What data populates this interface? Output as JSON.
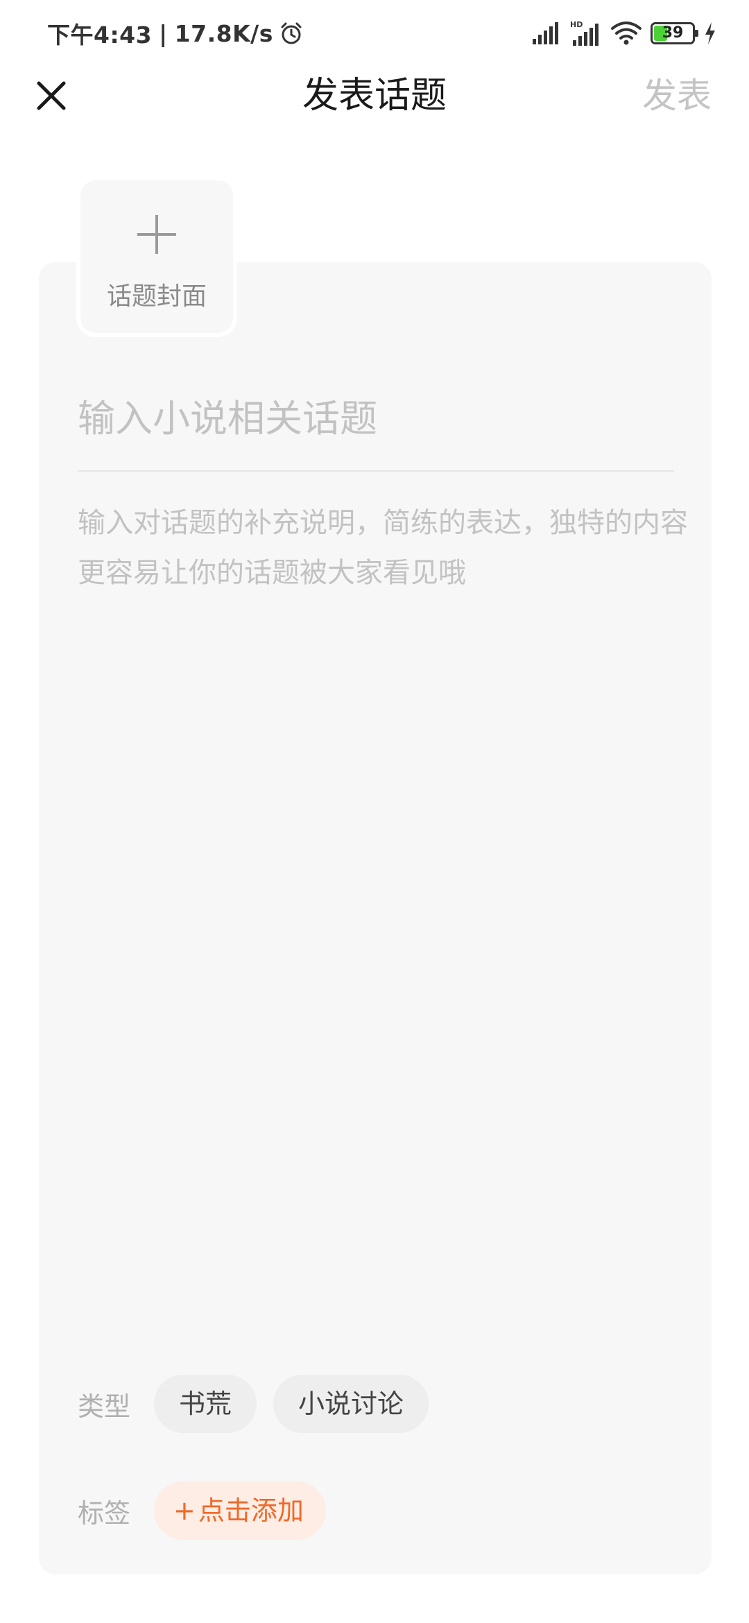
{
  "status_bar": {
    "time": "下午4:43",
    "separator": "|",
    "network_speed": "17.8K/s",
    "battery_level": "39",
    "battery_fraction": 0.39,
    "icons": [
      "alarm-icon",
      "cellular-signal-icon",
      "hd-cellular-signal-icon",
      "wifi-icon",
      "battery-icon",
      "charging-icon"
    ]
  },
  "nav": {
    "title": "发表话题",
    "publish_label": "发表",
    "close_icon": "close-icon"
  },
  "editor": {
    "cover_label": "话题封面",
    "title_placeholder": "输入小说相关话题",
    "title_value": "",
    "description_placeholder": "输入对话题的补充说明，简练的表达，独特的内容更容易让你的话题被大家看见哦",
    "description_value": ""
  },
  "meta": {
    "type_label": "类型",
    "types": [
      "书荒",
      "小说讨论"
    ],
    "tag_label": "标签",
    "add_tag_plus": "+",
    "add_tag_label": "点击添加"
  },
  "colors": {
    "accent": "#f0692a",
    "accent_bg": "#fdede4",
    "card_bg": "#f7f7f7",
    "placeholder": "#c2c2c2",
    "battery_green": "#4cd137"
  }
}
